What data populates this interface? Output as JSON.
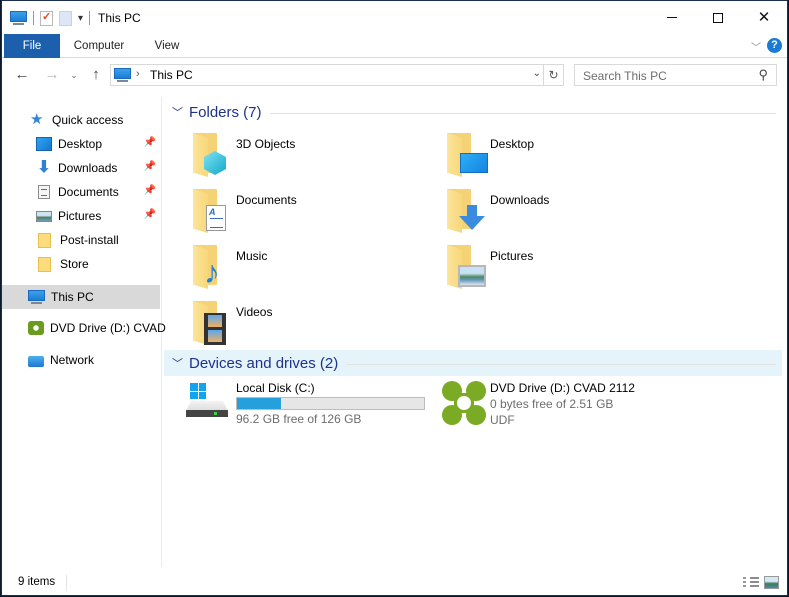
{
  "window": {
    "title": "This PC",
    "controls": {
      "minimize": "minimize",
      "maximize": "maximize",
      "close": "close"
    }
  },
  "quick_access_toolbar": {
    "icons": [
      "this-pc-icon",
      "properties-icon",
      "new-folder-icon",
      "customize-dropdown-icon"
    ]
  },
  "ribbon": {
    "tabs": [
      {
        "label": "File",
        "active": true
      },
      {
        "label": "Computer"
      },
      {
        "label": "View"
      }
    ],
    "help_label": "?",
    "accent_color": "#1c5fad"
  },
  "navigation": {
    "address_path": [
      "This PC"
    ],
    "address_separator": "›",
    "search_placeholder": "Search This PC"
  },
  "sidebar": {
    "quick_access": {
      "label": "Quick access",
      "items": [
        {
          "label": "Desktop",
          "icon": "desktop-icon",
          "pinned": true
        },
        {
          "label": "Downloads",
          "icon": "downloads-icon",
          "pinned": true
        },
        {
          "label": "Documents",
          "icon": "documents-icon",
          "pinned": true
        },
        {
          "label": "Pictures",
          "icon": "pictures-icon",
          "pinned": true
        },
        {
          "label": "Post-install",
          "icon": "folder-icon",
          "pinned": false
        },
        {
          "label": "Store",
          "icon": "folder-icon",
          "pinned": false
        }
      ]
    },
    "this_pc": {
      "label": "This PC",
      "selected": true
    },
    "dvd_drive": {
      "label": "DVD Drive (D:) CVAD"
    },
    "network": {
      "label": "Network"
    }
  },
  "content": {
    "folders_group": {
      "title": "Folders (7)",
      "items": [
        {
          "label": "3D Objects",
          "icon": "3d-objects-folder-icon"
        },
        {
          "label": "Desktop",
          "icon": "desktop-folder-icon"
        },
        {
          "label": "Documents",
          "icon": "documents-folder-icon"
        },
        {
          "label": "Downloads",
          "icon": "downloads-folder-icon"
        },
        {
          "label": "Music",
          "icon": "music-folder-icon"
        },
        {
          "label": "Pictures",
          "icon": "pictures-folder-icon"
        },
        {
          "label": "Videos",
          "icon": "videos-folder-icon"
        }
      ]
    },
    "devices_group": {
      "title": "Devices and drives (2)",
      "drives": [
        {
          "name": "Local Disk (C:)",
          "free_text": "96.2 GB free of 126 GB",
          "free_gb": 96.2,
          "total_gb": 126,
          "used_fraction": 0.237,
          "bar_color": "#26a0da"
        },
        {
          "name": "DVD Drive (D:) CVAD 2112",
          "free_text": "0 bytes free of 2.51 GB",
          "filesystem": "UDF"
        }
      ]
    }
  },
  "status_bar": {
    "item_count": "9 items"
  }
}
